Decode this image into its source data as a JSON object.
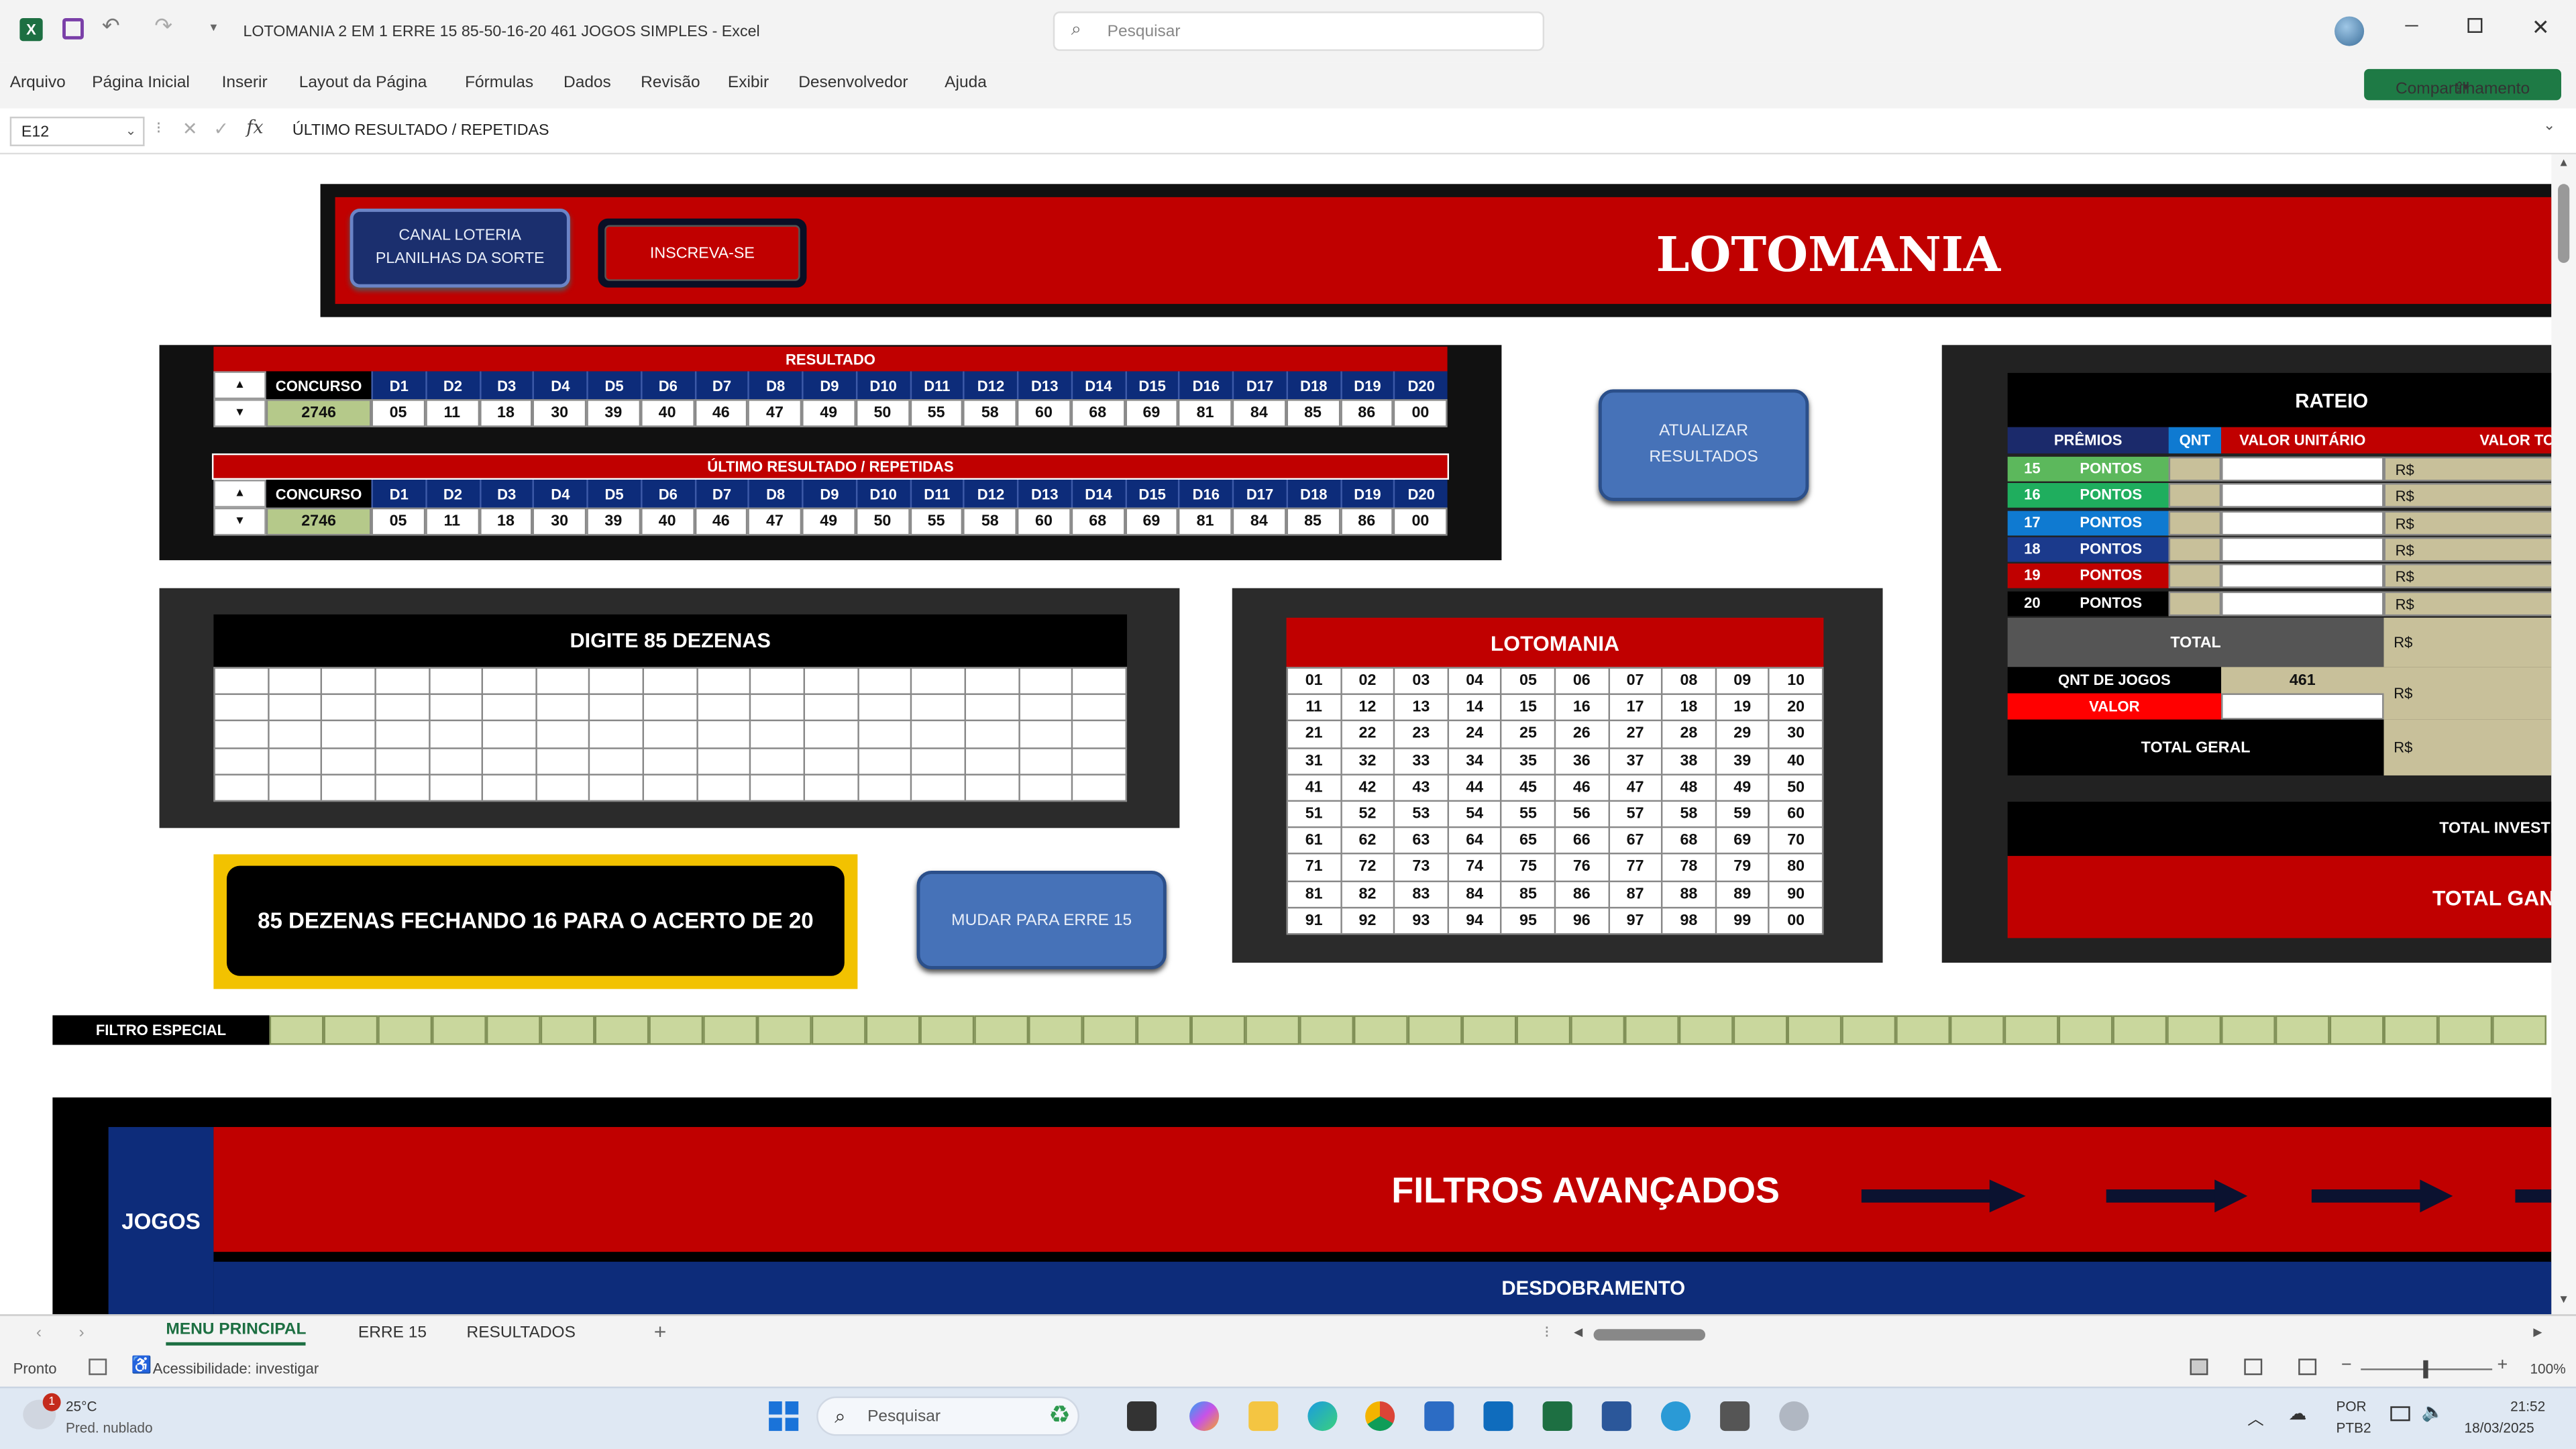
{
  "window": {
    "title": "LOTOMANIA 2 EM 1 ERRE 15 85-50-16-20 461 JOGOS SIMPLES - Excel",
    "search_placeholder": "Pesquisar",
    "share_label": "Compartilhamento"
  },
  "ribbon_tabs": [
    "Arquivo",
    "Página Inicial",
    "Inserir",
    "Layout da Página",
    "Fórmulas",
    "Dados",
    "Revisão",
    "Exibir",
    "Desenvolvedor",
    "Ajuda"
  ],
  "formula": {
    "name_box": "E12",
    "fx": "fx",
    "content": "ÚLTIMO RESULTADO / REPETIDAS"
  },
  "header": {
    "btn_canal": "CANAL LOTERIA PLANILHAS DA SORTE",
    "btn_inscreva": "INSCREVA-SE",
    "title": "LOTOMANIA"
  },
  "results": {
    "title1": "RESULTADO",
    "title2": "ÚLTIMO RESULTADO / REPETIDAS",
    "concurso_label": "CONCURSO",
    "columns": [
      "D1",
      "D2",
      "D3",
      "D4",
      "D5",
      "D6",
      "D7",
      "D8",
      "D9",
      "D10",
      "D11",
      "D12",
      "D13",
      "D14",
      "D15",
      "D16",
      "D17",
      "D18",
      "D19",
      "D20"
    ],
    "concurso": "2746",
    "numbers": [
      "05",
      "11",
      "18",
      "30",
      "39",
      "40",
      "46",
      "47",
      "49",
      "50",
      "55",
      "58",
      "60",
      "68",
      "69",
      "81",
      "84",
      "85",
      "86",
      "00"
    ]
  },
  "btn_atualizar": "ATUALIZAR RESULTADOS",
  "rateio": {
    "title": "RATEIO",
    "col_premios": "PRÊMIOS",
    "col_qnt": "QNT",
    "col_valor_unit": "VALOR UNITÁRIO",
    "col_valor_total": "VALOR TO",
    "rows": [
      {
        "n": "15",
        "label": "PONTOS",
        "color": "#5cb85c"
      },
      {
        "n": "16",
        "label": "PONTOS",
        "color": "#1fae5e"
      },
      {
        "n": "17",
        "label": "PONTOS",
        "color": "#0f7ad1"
      },
      {
        "n": "18",
        "label": "PONTOS",
        "color": "#1b3a8c"
      },
      {
        "n": "19",
        "label": "PONTOS",
        "color": "#c00000"
      },
      {
        "n": "20",
        "label": "PONTOS",
        "color": "#000000"
      }
    ],
    "currency": "R$",
    "total": "TOTAL",
    "qnt_jogos_label": "QNT DE JOGOS",
    "qnt_jogos": "461",
    "valor_label": "VALOR",
    "total_geral": "TOTAL GERAL",
    "total_investido": "TOTAL INVESTI",
    "total_ganho": "TOTAL GAN"
  },
  "digite": {
    "title": "DIGITE 85 DEZENAS"
  },
  "lotomania_grid": {
    "title": "LOTOMANIA",
    "numbers": [
      "01",
      "02",
      "03",
      "04",
      "05",
      "06",
      "07",
      "08",
      "09",
      "10",
      "11",
      "12",
      "13",
      "14",
      "15",
      "16",
      "17",
      "18",
      "19",
      "20",
      "21",
      "22",
      "23",
      "24",
      "25",
      "26",
      "27",
      "28",
      "29",
      "30",
      "31",
      "32",
      "33",
      "34",
      "35",
      "36",
      "37",
      "38",
      "39",
      "40",
      "41",
      "42",
      "43",
      "44",
      "45",
      "46",
      "47",
      "48",
      "49",
      "50",
      "51",
      "52",
      "53",
      "54",
      "55",
      "56",
      "57",
      "58",
      "59",
      "60",
      "61",
      "62",
      "63",
      "64",
      "65",
      "66",
      "67",
      "68",
      "69",
      "70",
      "71",
      "72",
      "73",
      "74",
      "75",
      "76",
      "77",
      "78",
      "79",
      "80",
      "81",
      "82",
      "83",
      "84",
      "85",
      "86",
      "87",
      "88",
      "89",
      "90",
      "91",
      "92",
      "93",
      "94",
      "95",
      "96",
      "97",
      "98",
      "99",
      "00"
    ]
  },
  "info_box": "85 DEZENAS FECHANDO 16 PARA O ACERTO DE 20",
  "btn_mudar": "MUDAR PARA ERRE 15",
  "filtro_especial": "FILTRO ESPECIAL",
  "jogos_label": "JOGOS",
  "filtros_avancados": "FILTROS AVANÇADOS",
  "desdobramento": "DESDOBRAMENTO",
  "sheet_tabs": [
    "MENU PRINCIPAL",
    "ERRE 15",
    "RESULTADOS"
  ],
  "status": {
    "ready": "Pronto",
    "accessibility": "Acessibilidade: investigar",
    "zoom": "100%"
  },
  "taskbar": {
    "weather_temp": "25°C",
    "weather_desc": "Pred. nublado",
    "weather_badge": "1",
    "search": "Pesquisar",
    "lang": "POR",
    "layout": "PTB2",
    "time": "21:52",
    "date": "18/03/2025"
  }
}
